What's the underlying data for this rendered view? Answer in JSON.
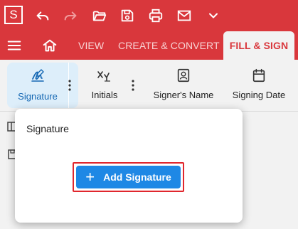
{
  "titlebar": {
    "logo_letter": "S",
    "quick_access": [
      "undo-icon",
      "redo-icon",
      "open-folder-icon",
      "save-icon",
      "print-icon",
      "mail-icon",
      "chevron-down-icon"
    ]
  },
  "nav": {
    "icons": [
      "menu-icon",
      "home-icon"
    ],
    "tabs": [
      {
        "label": "VIEW",
        "active": false
      },
      {
        "label": "CREATE & CONVERT",
        "active": false
      },
      {
        "label": "FILL & SIGN",
        "active": true
      }
    ]
  },
  "toolbar": {
    "tools": [
      {
        "label": "Signature",
        "icon": "signature-pen-icon",
        "selected": true
      },
      {
        "label": "Initials",
        "icon": "initials-icon",
        "selected": false
      },
      {
        "label": "Signer's Name",
        "icon": "contact-card-icon",
        "selected": false
      },
      {
        "label": "Signing Date",
        "icon": "calendar-icon",
        "selected": false
      }
    ]
  },
  "popover": {
    "title": "Signature",
    "add_button_label": "Add Signature",
    "add_button_icon": "plus-icon"
  },
  "colors": {
    "brand_red": "#d9373c",
    "accent_blue": "#1e88e5",
    "selected_bg": "#ddeefa",
    "highlight_red": "#e0262d"
  }
}
